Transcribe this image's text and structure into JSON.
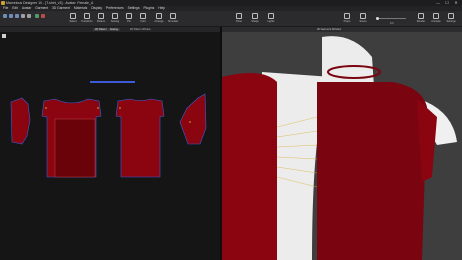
{
  "window": {
    "title": "Marvelous Designer 10 - [T-shirt_v3] - Avatar: Female_A",
    "controls": [
      "—",
      "☐",
      "✕"
    ]
  },
  "menu": {
    "items": [
      "File",
      "Edit",
      "Avatar",
      "Garment",
      "3D Garment",
      "Materials",
      "Display",
      "Preferences",
      "Settings",
      "Plugins",
      "Help"
    ]
  },
  "toolbar": {
    "left_buttons": [
      {
        "label": "Select",
        "icon": "select-icon"
      },
      {
        "label": "Transform",
        "icon": "transform-icon"
      },
      {
        "label": "Pattern",
        "icon": "pattern-icon"
      },
      {
        "label": "Sewing",
        "icon": "sewing-icon"
      },
      {
        "label": "Pin",
        "icon": "pin-icon"
      },
      {
        "label": "Fold",
        "icon": "fold-icon"
      },
      {
        "label": "Arrange",
        "icon": "arrange-icon"
      },
      {
        "label": "Simulate",
        "icon": "simulate-icon"
      }
    ],
    "right_buttons": [
      {
        "label": "Pose",
        "icon": "pose-icon"
      },
      {
        "label": "Shape",
        "icon": "shape-icon"
      },
      {
        "label": "Lights",
        "icon": "lights-icon"
      },
      {
        "label": "Props",
        "icon": "props-icon"
      },
      {
        "label": "Scene",
        "icon": "scene-icon"
      },
      {
        "label": "Render",
        "icon": "render-icon"
      },
      {
        "label": "Animate",
        "icon": "animate-icon"
      },
      {
        "label": "Settings",
        "icon": "settings-icon"
      }
    ],
    "slider_value": "0.3"
  },
  "view2d": {
    "tabs": [
      "2D Pattern",
      "Sewing"
    ],
    "title": "2D Pattern Window"
  },
  "view3d": {
    "title": "3D Garment Window"
  },
  "colors": {
    "garment": "#8a0510",
    "garment_dark": "#6a0309",
    "seam": "#3d5bd8",
    "accent": "#d8b23a"
  }
}
